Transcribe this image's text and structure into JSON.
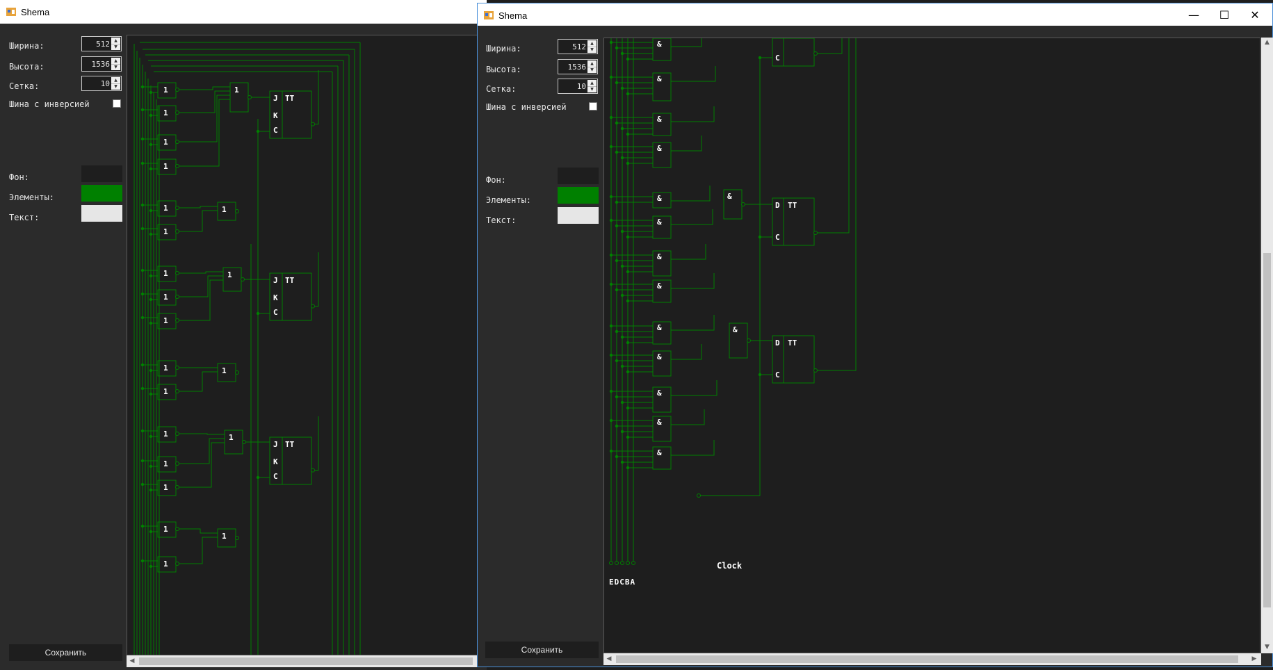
{
  "colors": {
    "background": "#1e1e1e",
    "elements": "#008000",
    "text": "#e6e6e6",
    "panel": "#2b2b2b"
  },
  "back_window": {
    "title": "Shema",
    "labels": {
      "width": "Ширина:",
      "height": "Высота:",
      "grid": "Сетка:",
      "inversion_bus": "Шина с инверсией",
      "bg": "Фон:",
      "elements": "Элементы:",
      "text": "Текст:"
    },
    "values": {
      "width": "512",
      "height": "1536",
      "grid": "10"
    },
    "save_label": "Сохранить",
    "gate_labels": {
      "or": "1",
      "j": "J",
      "k": "K",
      "c": "C",
      "tt": "TT"
    }
  },
  "front_window": {
    "title": "Shema",
    "controls": {
      "minimize": "—",
      "maximize": "☐",
      "close": "✕"
    },
    "labels": {
      "width": "Ширина:",
      "height": "Высота:",
      "grid": "Сетка:",
      "inversion_bus": "Шина с инверсией",
      "bg": "Фон:",
      "elements": "Элементы:",
      "text": "Текст:"
    },
    "values": {
      "width": "512",
      "height": "1536",
      "grid": "10"
    },
    "save_label": "Сохранить",
    "gate_labels": {
      "and": "&",
      "d": "D",
      "c": "C",
      "tt": "TT"
    },
    "inputs_label": "EDCBA",
    "clock_label": "Clock"
  }
}
